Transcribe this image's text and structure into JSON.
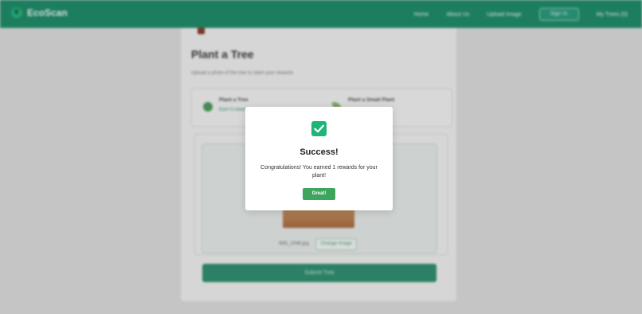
{
  "nav": {
    "brand": "EcoScan",
    "links": [
      "Home",
      "About Us",
      "Upload Image"
    ],
    "button": "Sign In",
    "user": "My Trees (0)"
  },
  "page": {
    "title": "Plant a Tree",
    "subtitle": "Upload a photo of the tree to claim your rewards",
    "options": [
      {
        "title": "Plant a Tree",
        "desc": "Earn 5 tokens"
      },
      {
        "title": "Plant a Small Plant",
        "desc": ""
      }
    ],
    "file_name": "IMG_2048.jpg",
    "change_label": "Change Image",
    "submit_label": "Submit Tree"
  },
  "modal": {
    "icon": "check-icon",
    "title": "Success!",
    "message": "Congratulations! You earned 1 rewards for your plant!",
    "button": "Great!",
    "accent": "#1fb47a",
    "button_color": "#3fa55d"
  }
}
